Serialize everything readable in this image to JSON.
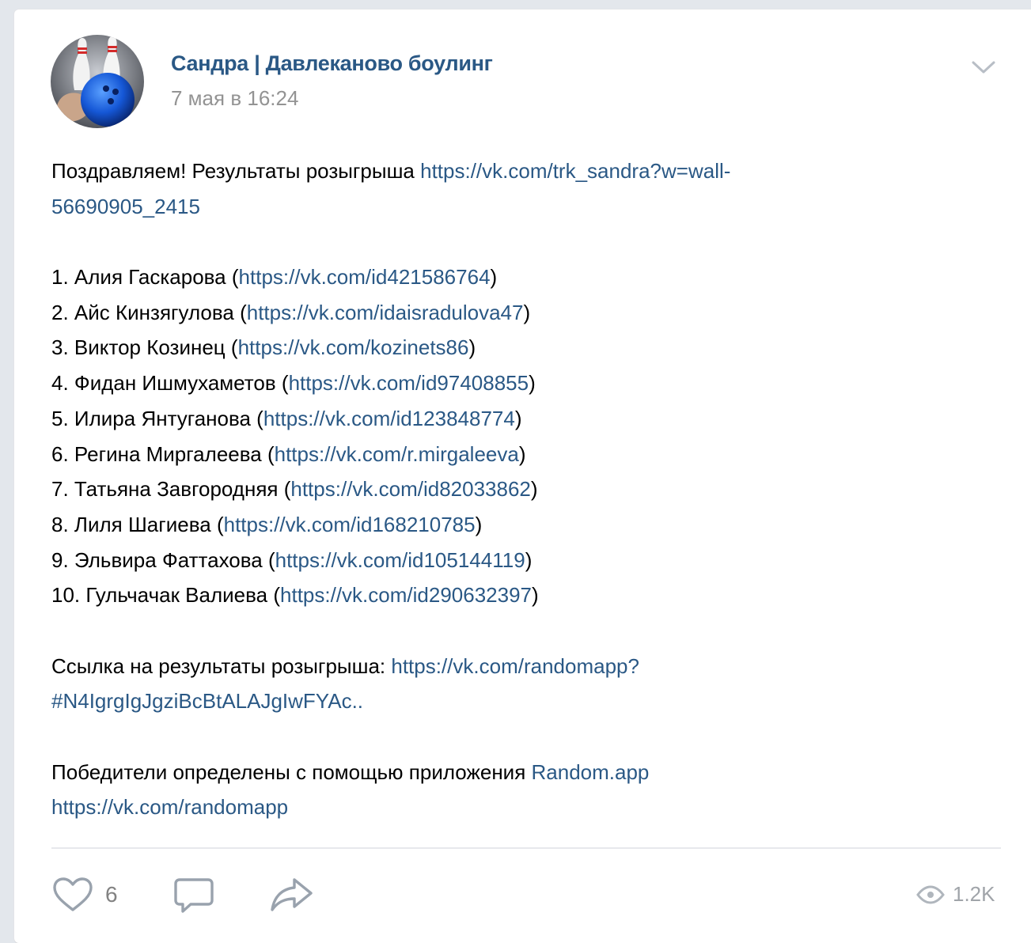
{
  "post": {
    "author": "Сандра | Давлеканово боулинг",
    "date": "7 мая в 16:24",
    "intro_text": "Поздравляем! Результаты розыгрыша ",
    "intro_link_part1": "https://vk.com/trk_sandra?w=wall-",
    "intro_link_part2": "56690905_2415",
    "winners": [
      {
        "num": "1.",
        "name": "Алия Гаскарова",
        "url": "https://vk.com/id421586764"
      },
      {
        "num": "2.",
        "name": "Айс Кинзягулова",
        "url": "https://vk.com/idaisradulova47"
      },
      {
        "num": "3.",
        "name": "Виктор Козинец",
        "url": "https://vk.com/kozinets86"
      },
      {
        "num": "4.",
        "name": "Фидан Ишмухаметов",
        "url": "https://vk.com/id97408855"
      },
      {
        "num": "5.",
        "name": "Илира Янтуганова",
        "url": "https://vk.com/id123848774"
      },
      {
        "num": "6.",
        "name": "Регина Миргалеева",
        "url": "https://vk.com/r.mirgaleeva"
      },
      {
        "num": "7.",
        "name": "Татьяна Завгородняя",
        "url": "https://vk.com/id82033862"
      },
      {
        "num": "8.",
        "name": "Лиля Шагиева",
        "url": "https://vk.com/id168210785"
      },
      {
        "num": "9.",
        "name": "Эльвира Фаттахова",
        "url": "https://vk.com/id105144119"
      },
      {
        "num": "10.",
        "name": "Гульчачак Валиева",
        "url": "https://vk.com/id290632397"
      }
    ],
    "results_text": "Ссылка на результаты розыгрыша: ",
    "results_link_part1": "https://vk.com/randomapp?",
    "results_link_part2": "#N4IgrgIgJgziBcBtALAJgIwFYAc..",
    "winners_text": "Победители определены с помощью приложения ",
    "app_name_link": "Random.app",
    "app_url_link": "https://vk.com/randomapp"
  },
  "footer": {
    "likes": "6",
    "views": "1.2K"
  },
  "icons": {
    "like": "heart-icon",
    "comment": "comment-icon",
    "share": "share-icon",
    "views": "eye-icon",
    "menu": "chevron-down-icon"
  },
  "colors": {
    "link": "#2a5885",
    "muted": "#939393",
    "icon": "#99a2ad"
  }
}
